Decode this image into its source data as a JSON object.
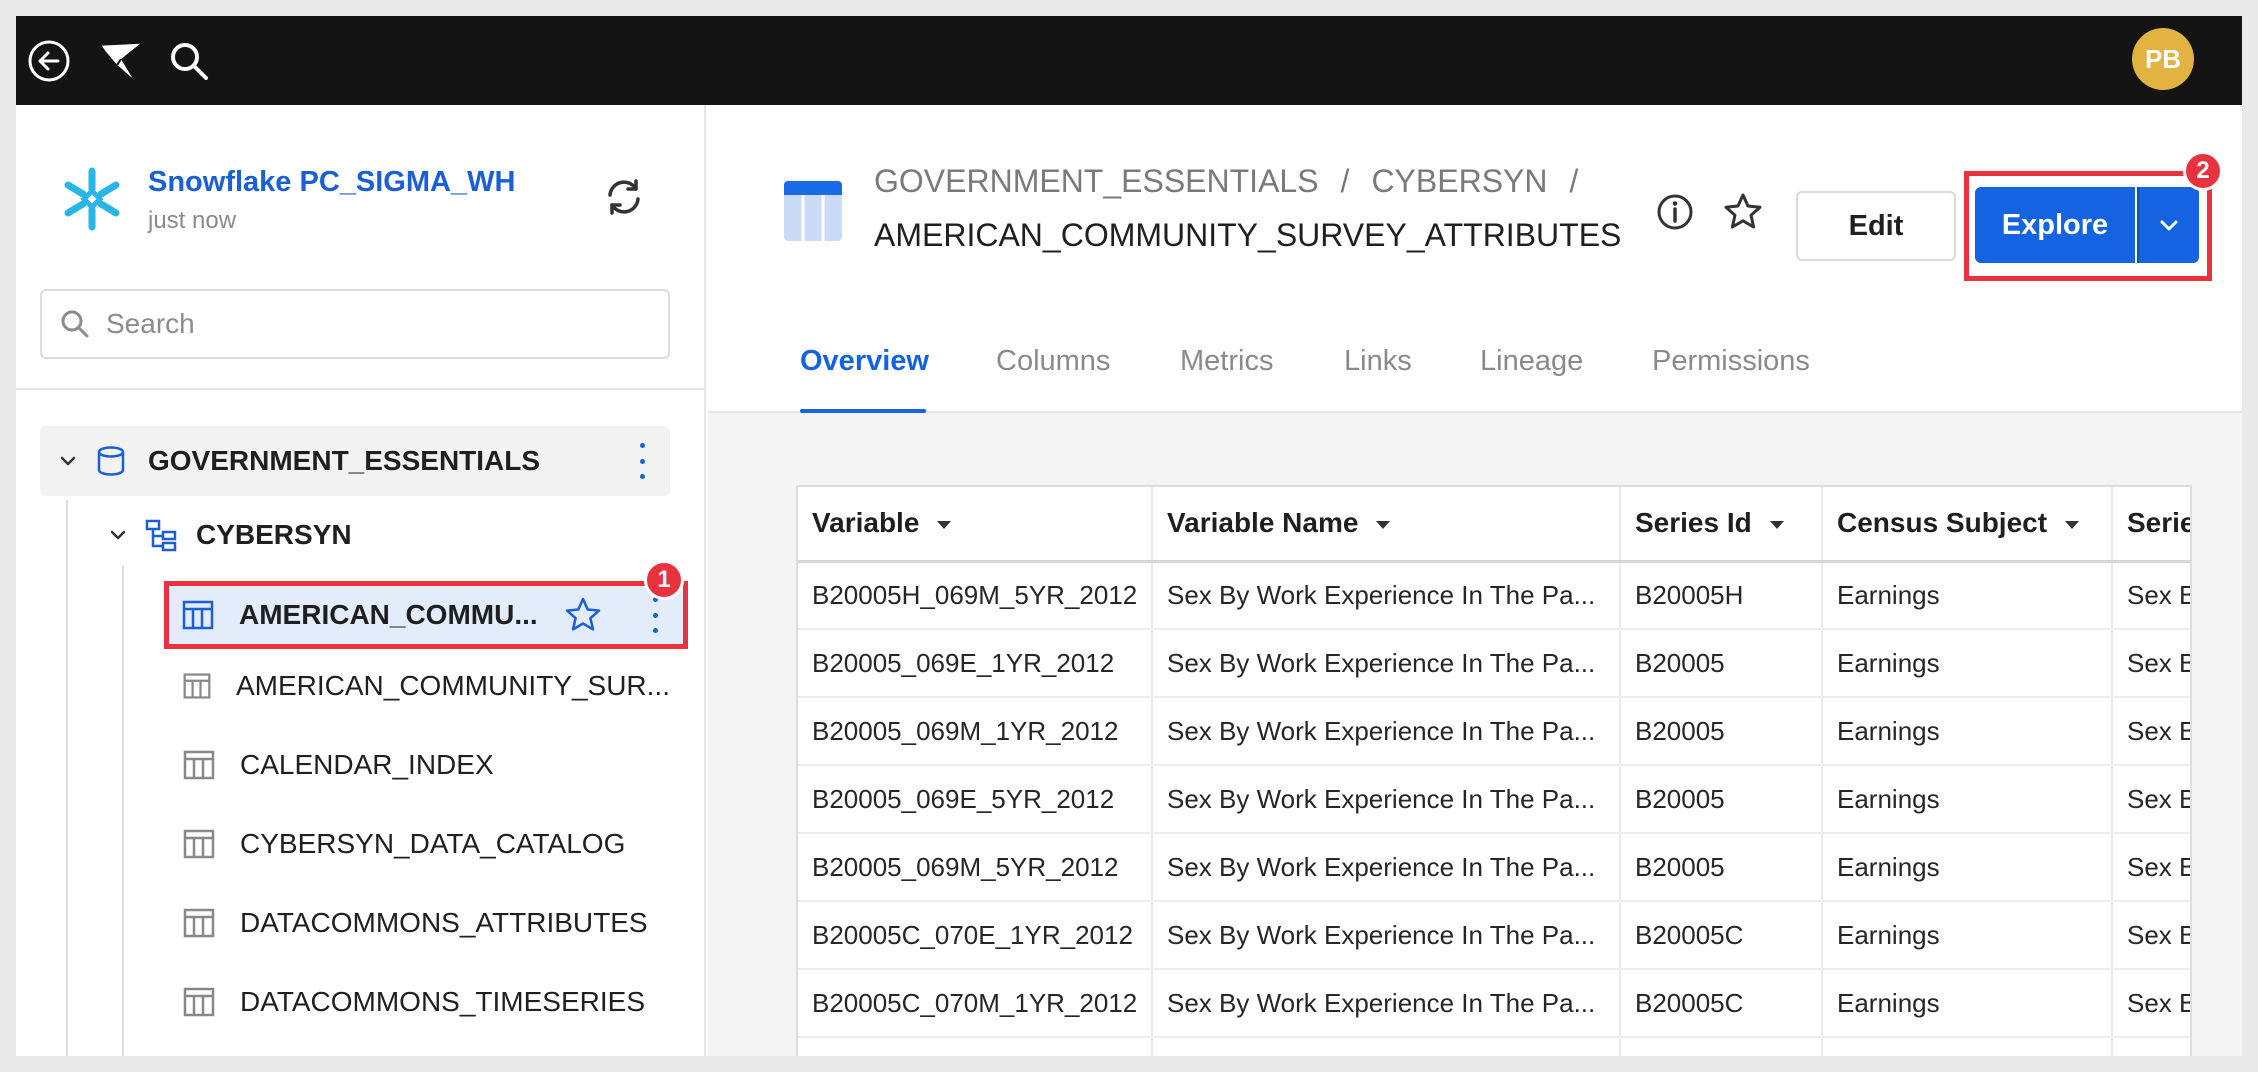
{
  "topbar": {
    "avatar_initials": "PB"
  },
  "sidebar": {
    "connection": {
      "name": "Snowflake PC_SIGMA_WH",
      "updated": "just now"
    },
    "search_placeholder": "Search",
    "database": "GOVERNMENT_ESSENTIALS",
    "schema": "CYBERSYN",
    "tables": [
      "AMERICAN_COMMU...",
      "AMERICAN_COMMUNITY_SUR...",
      "CALENDAR_INDEX",
      "CYBERSYN_DATA_CATALOG",
      "DATACOMMONS_ATTRIBUTES",
      "DATACOMMONS_TIMESERIES"
    ]
  },
  "badges": {
    "one": "1",
    "two": "2"
  },
  "header": {
    "breadcrumb": [
      "GOVERNMENT_ESSENTIALS",
      "/",
      "CYBERSYN",
      "/"
    ],
    "title": "AMERICAN_COMMUNITY_SURVEY_ATTRIBUTES",
    "edit_label": "Edit",
    "explore_label": "Explore"
  },
  "tabs": [
    "Overview",
    "Columns",
    "Metrics",
    "Links",
    "Lineage",
    "Permissions"
  ],
  "grid": {
    "columns": [
      "Variable",
      "Variable Name",
      "Series Id",
      "Census Subject",
      "Serie"
    ],
    "rows": [
      [
        "B20005H_069M_5YR_2012",
        "Sex By Work Experience In The Pa...",
        "B20005H",
        "Earnings",
        "Sex B"
      ],
      [
        "B20005_069E_1YR_2012",
        "Sex By Work Experience In The Pa...",
        "B20005",
        "Earnings",
        "Sex B"
      ],
      [
        "B20005_069M_1YR_2012",
        "Sex By Work Experience In The Pa...",
        "B20005",
        "Earnings",
        "Sex B"
      ],
      [
        "B20005_069E_5YR_2012",
        "Sex By Work Experience In The Pa...",
        "B20005",
        "Earnings",
        "Sex B"
      ],
      [
        "B20005_069M_5YR_2012",
        "Sex By Work Experience In The Pa...",
        "B20005",
        "Earnings",
        "Sex B"
      ],
      [
        "B20005C_070E_1YR_2012",
        "Sex By Work Experience In The Pa...",
        "B20005C",
        "Earnings",
        "Sex B"
      ],
      [
        "B20005C_070M_1YR_2012",
        "Sex By Work Experience In The Pa...",
        "B20005C",
        "Earnings",
        "Sex B"
      ],
      [
        "",
        "",
        "",
        "",
        ""
      ]
    ]
  },
  "colors": {
    "accent": "#1463e0",
    "highlight": "#e8333f",
    "topbar": "#141414",
    "avatar": "#e3b341"
  }
}
